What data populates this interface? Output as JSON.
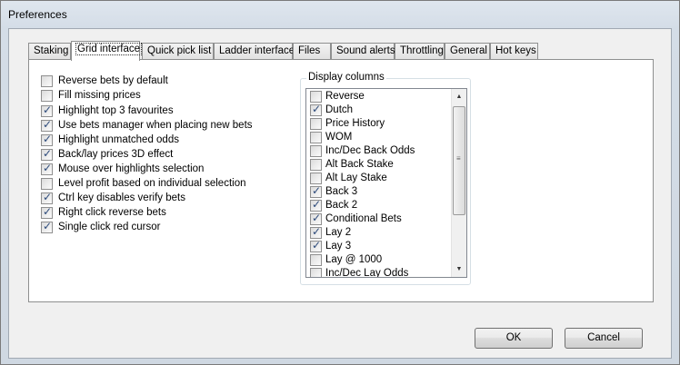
{
  "window": {
    "title": "Preferences"
  },
  "tabs": [
    {
      "label": "Staking",
      "active": false
    },
    {
      "label": "Grid interface",
      "active": true
    },
    {
      "label": "Quick pick list",
      "active": false
    },
    {
      "label": "Ladder interface",
      "active": false
    },
    {
      "label": "Files",
      "active": false
    },
    {
      "label": "Sound alerts",
      "active": false
    },
    {
      "label": "Throttling",
      "active": false
    },
    {
      "label": "General",
      "active": false
    },
    {
      "label": "Hot keys",
      "active": false
    }
  ],
  "options": [
    {
      "label": "Reverse bets by default",
      "checked": false
    },
    {
      "label": "Fill missing prices",
      "checked": false
    },
    {
      "label": "Highlight top 3 favourites",
      "checked": true
    },
    {
      "label": "Use bets manager when placing new bets",
      "checked": true
    },
    {
      "label": "Highlight unmatched odds",
      "checked": true
    },
    {
      "label": "Back/lay prices 3D effect",
      "checked": true
    },
    {
      "label": "Mouse over highlights selection",
      "checked": true
    },
    {
      "label": "Level profit based on individual selection",
      "checked": false
    },
    {
      "label": "Ctrl key disables verify bets",
      "checked": true
    },
    {
      "label": "Right click reverse bets",
      "checked": true
    },
    {
      "label": "Single click red cursor",
      "checked": true
    }
  ],
  "display_columns": {
    "title": "Display columns",
    "items": [
      {
        "label": "Reverse",
        "checked": false
      },
      {
        "label": "Dutch",
        "checked": true
      },
      {
        "label": "Price History",
        "checked": false
      },
      {
        "label": "WOM",
        "checked": false
      },
      {
        "label": "Inc/Dec Back Odds",
        "checked": false
      },
      {
        "label": "Alt Back Stake",
        "checked": false
      },
      {
        "label": "Alt Lay Stake",
        "checked": false
      },
      {
        "label": "Back 3",
        "checked": true
      },
      {
        "label": "Back 2",
        "checked": true
      },
      {
        "label": "Conditional Bets",
        "checked": true
      },
      {
        "label": "Lay 2",
        "checked": true
      },
      {
        "label": "Lay 3",
        "checked": true
      },
      {
        "label": "Lay @ 1000",
        "checked": false
      },
      {
        "label": "Inc/Dec Lay Odds",
        "checked": false
      }
    ]
  },
  "buttons": {
    "ok": "OK",
    "cancel": "Cancel"
  }
}
